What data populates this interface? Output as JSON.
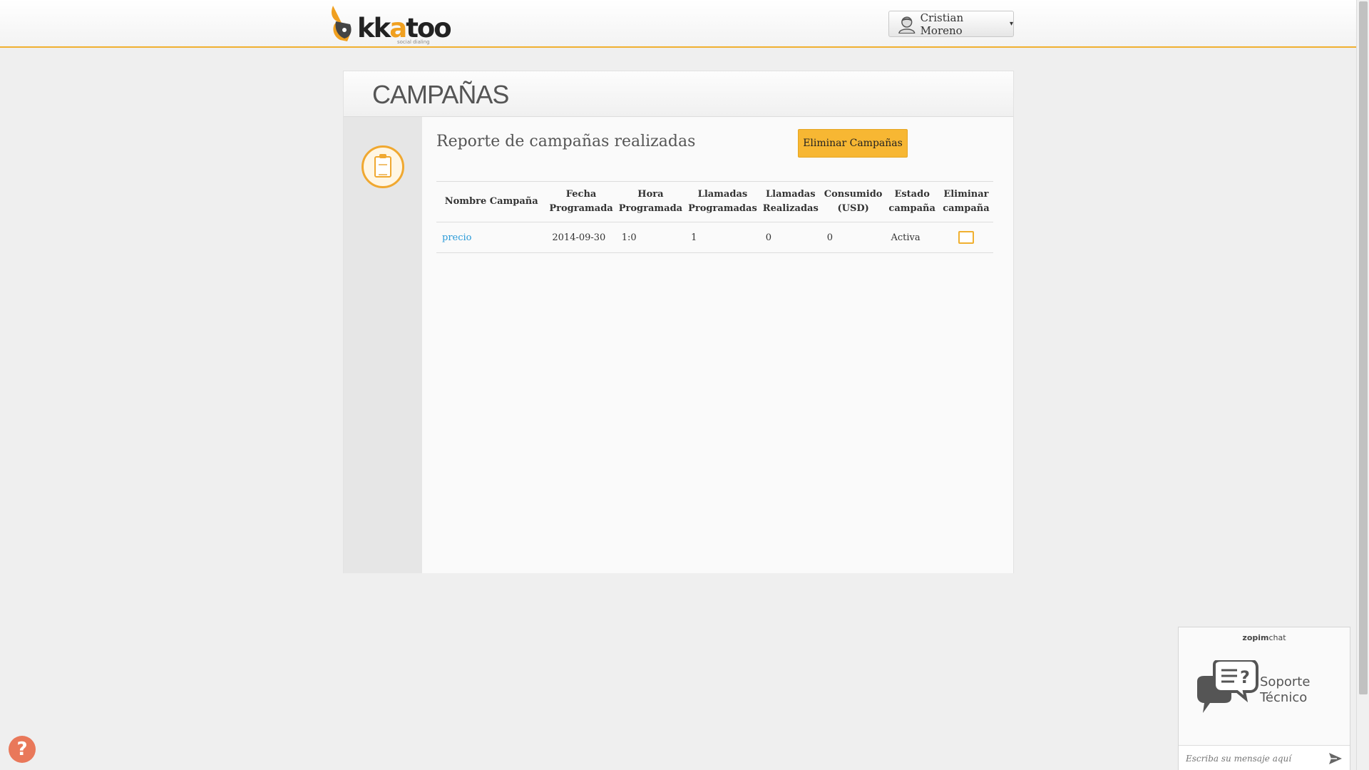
{
  "header": {
    "logo_text": "kkatoo",
    "logo_tagline": "social dialing",
    "user_name": "Cristian Moreno",
    "user_icon": "user-avatar-icon"
  },
  "panel": {
    "title": "CAMPAÑAS",
    "side_icon": "clipboard-icon",
    "report_title": "Reporte de campañas realizadas",
    "delete_button": "Eliminar Campañas"
  },
  "table": {
    "headers": {
      "name": "Nombre Campaña",
      "date_1": "Fecha",
      "date_2": "Programada",
      "time_1": "Hora",
      "time_2": "Programada",
      "sched_1": "Llamadas",
      "sched_2": "Programadas",
      "done_1": "Llamadas",
      "done_2": "Realizadas",
      "used_1": "Consumido",
      "used_2": "(USD)",
      "state_1": "Estado",
      "state_2": "campaña",
      "del_1": "Eliminar",
      "del_2": "campaña"
    },
    "rows": [
      {
        "name": "precio",
        "date": "2014-09-30",
        "time": "1:0",
        "scheduled": "1",
        "done": "0",
        "consumed": "0",
        "status": "Activa",
        "delete_checked": false
      }
    ]
  },
  "help": {
    "icon": "question-icon",
    "symbol": "?"
  },
  "chat": {
    "brand_bold": "zopim",
    "brand_rest": "chat",
    "label_1": "Soporte",
    "label_2": "Técnico",
    "input_placeholder": "Escriba su mensaje aquí",
    "send_icon": "send-icon"
  },
  "colors": {
    "accent": "#f0b030",
    "button": "#f7b733",
    "link": "#2a9ad8",
    "help": "#e9785a"
  }
}
